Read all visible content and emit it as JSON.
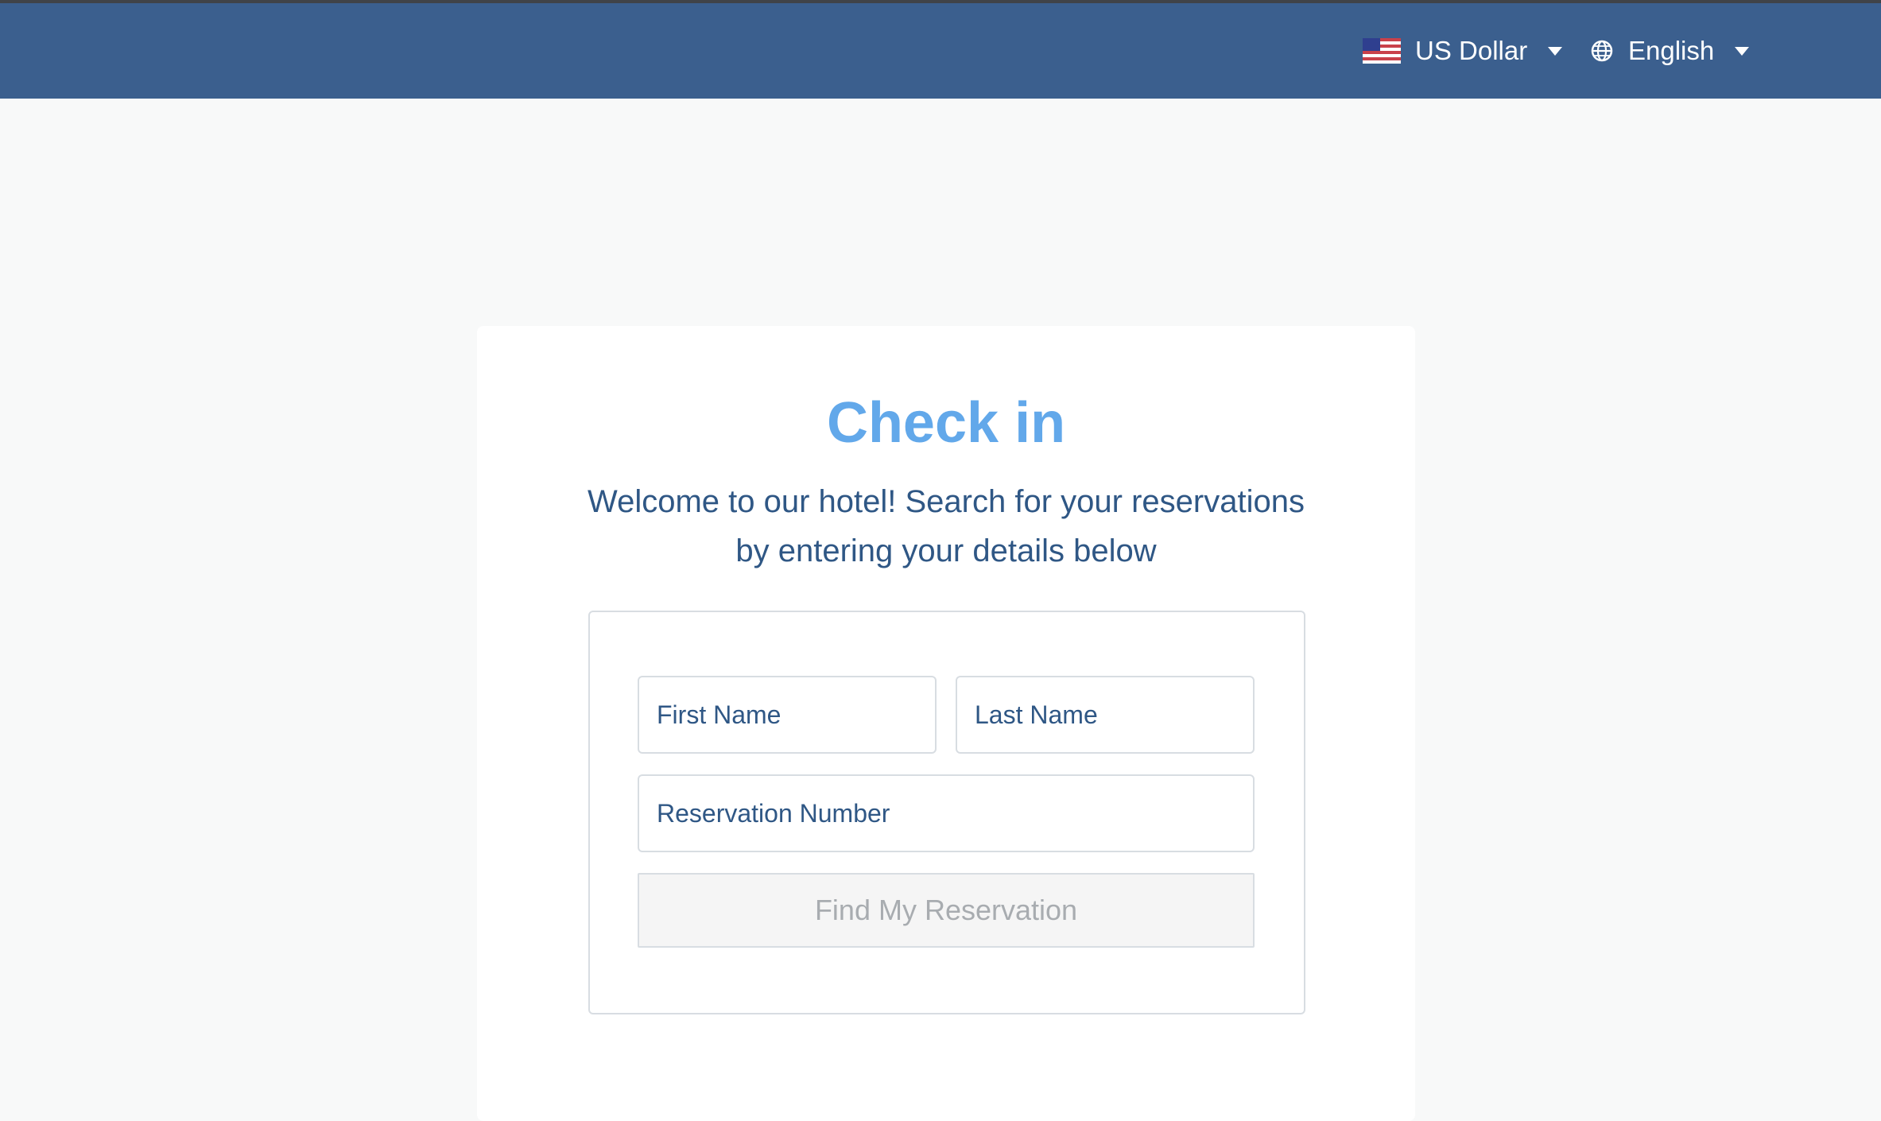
{
  "header": {
    "currency": {
      "label": "US Dollar",
      "flag_icon": "us-flag-icon",
      "dropdown_icon": "caret-down-icon"
    },
    "language": {
      "label": "English",
      "icon": "globe-icon",
      "dropdown_icon": "caret-down-icon"
    }
  },
  "checkin": {
    "title": "Check in",
    "subtitle_line1": "Welcome to our hotel! Search for your reservations",
    "subtitle_line2": "by entering your details below"
  },
  "form": {
    "first_name_placeholder": "First Name",
    "first_name_value": "",
    "last_name_placeholder": "Last Name",
    "last_name_value": "",
    "reservation_number_placeholder": "Reservation Number",
    "reservation_number_value": "",
    "submit_label": "Find My Reservation",
    "submit_state": "disabled"
  },
  "colors": {
    "header_background": "#3b5f8e",
    "page_background": "#f8f9f9",
    "title": "#62a8ea",
    "text": "#2f5785",
    "disabled_button_text": "#a8acb0",
    "disabled_button_background": "#f5f5f5"
  }
}
